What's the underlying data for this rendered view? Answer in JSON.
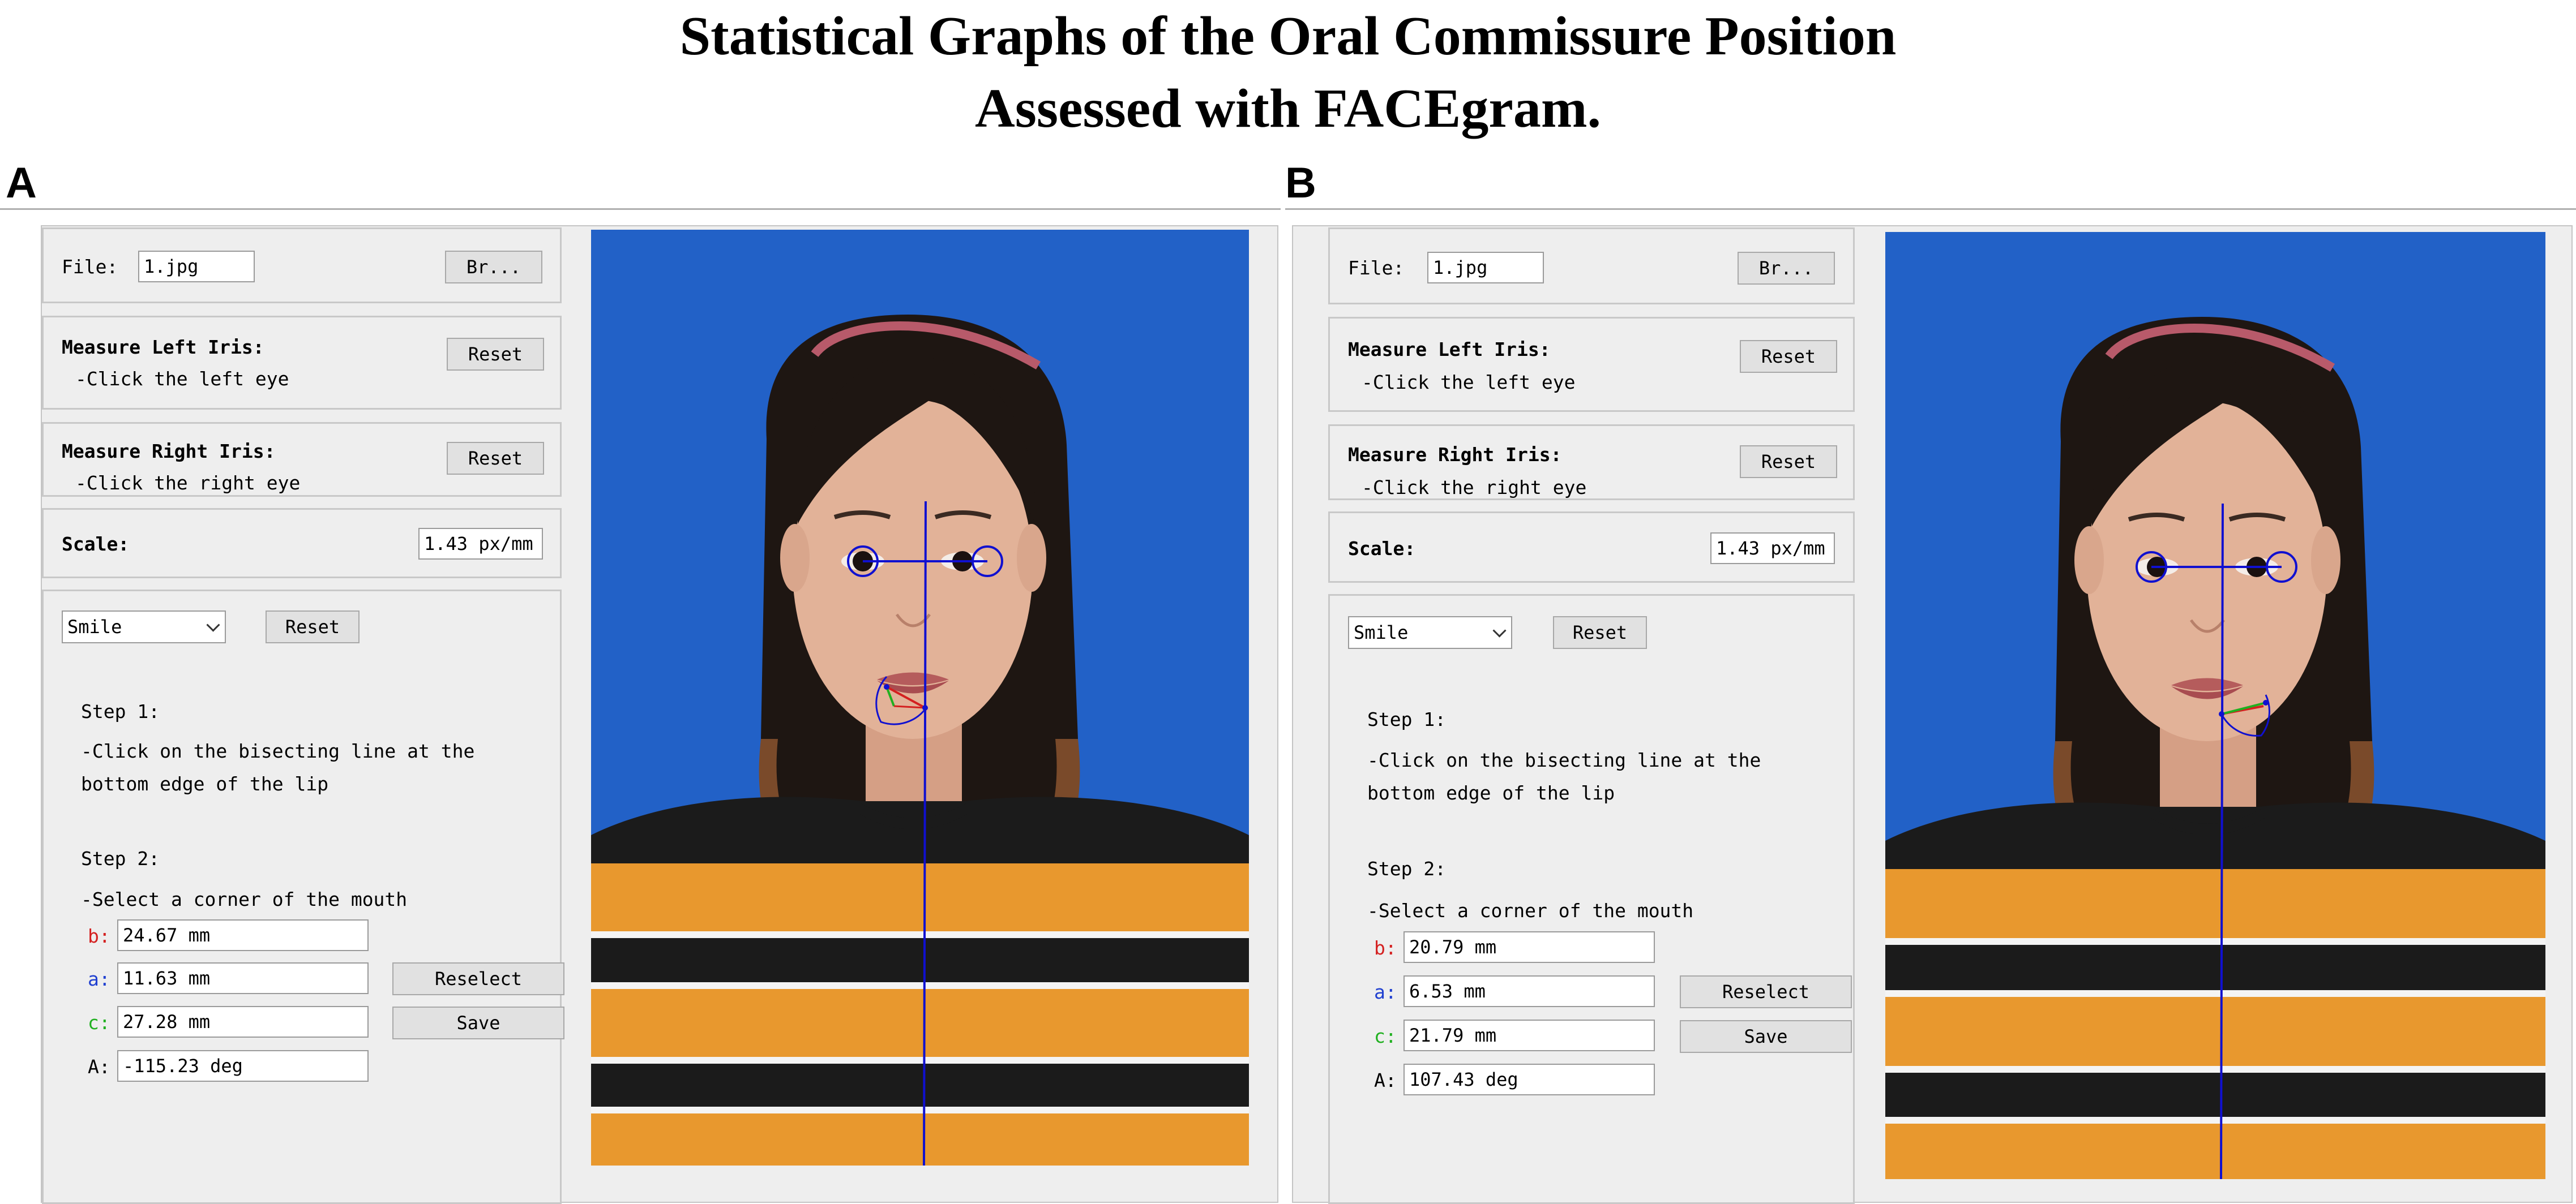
{
  "title": {
    "line1": "Statistical Graphs of the Oral Commissure Position",
    "line2": "Assessed with FACEgram."
  },
  "panels": [
    {
      "letter": "A",
      "file_label": "File:",
      "file_value": "1.jpg",
      "browse_label": "Br...",
      "left_iris_title": "Measure Left Iris:",
      "left_iris_hint": "-Click the left eye",
      "right_iris_title": "Measure Right Iris:",
      "right_iris_hint": "-Click the right eye",
      "reset_label": "Reset",
      "scale_label": "Scale:",
      "scale_value": "1.43 px/mm",
      "mode_select": "Smile",
      "step1_title": "Step 1:",
      "step1_line1": "-Click on the bisecting line at the",
      "step1_line2": "bottom edge of the lip",
      "step2_title": "Step 2:",
      "step2_line1": "-Select a corner of the mouth",
      "b_label": "b:",
      "b_value": "24.67 mm",
      "a_label": "a:",
      "a_value": "11.63 mm",
      "c_label": "c:",
      "c_value": "27.28 mm",
      "A_label": "A:",
      "A_value": "-115.23 deg",
      "reselect_label": "Reselect",
      "save_label": "Save"
    },
    {
      "letter": "B",
      "file_label": "File:",
      "file_value": "1.jpg",
      "browse_label": "Br...",
      "left_iris_title": "Measure Left Iris:",
      "left_iris_hint": "-Click the left eye",
      "right_iris_title": "Measure Right Iris:",
      "right_iris_hint": "-Click the right eye",
      "reset_label": "Reset",
      "scale_label": "Scale:",
      "scale_value": "1.43 px/mm",
      "mode_select": "Smile",
      "step1_title": "Step 1:",
      "step1_line1": "-Click on the bisecting line at the",
      "step1_line2": "bottom edge of the lip",
      "step2_title": "Step 2:",
      "step2_line1": "-Select a corner of the mouth",
      "b_label": "b:",
      "b_value": "20.79 mm",
      "a_label": "a:",
      "a_value": "6.53 mm",
      "c_label": "c:",
      "c_value": "21.79 mm",
      "A_label": "A:",
      "A_value": "107.43 deg",
      "reselect_label": "Reselect",
      "save_label": "Save"
    }
  ],
  "colors": {
    "b_label": "#d42020",
    "a_label": "#2040d0",
    "c_label": "#20b020",
    "A_label": "#000000",
    "photo_background": "#1f5fc4",
    "overlay_line": "#1010d0"
  },
  "icons": {
    "select_arrow": "chevron-down-icon"
  }
}
